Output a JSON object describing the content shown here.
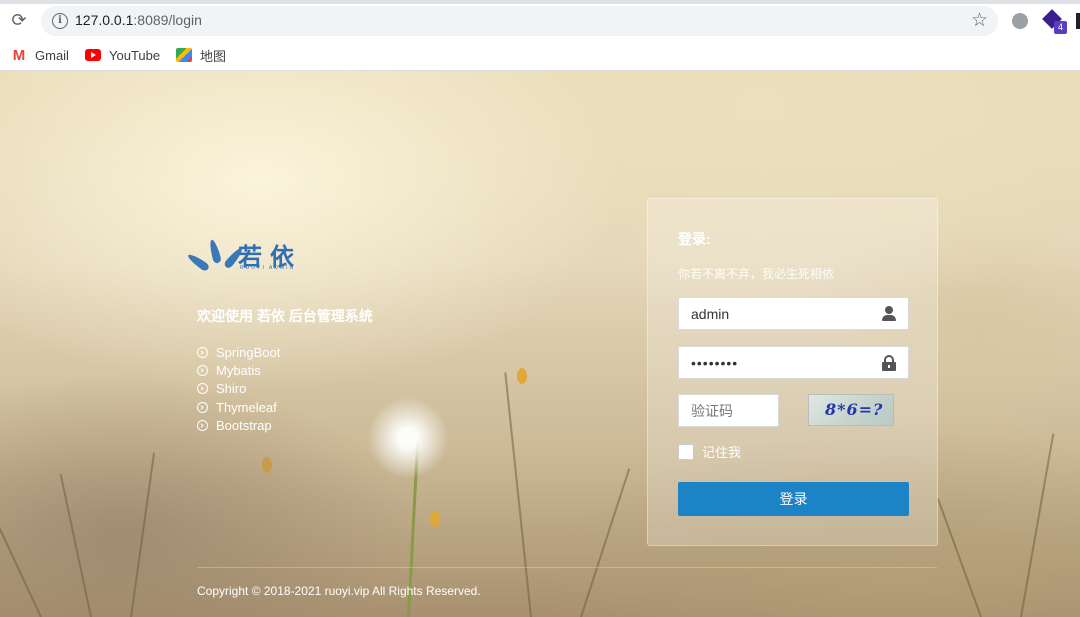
{
  "browser": {
    "url_host": "127.0.0.1",
    "url_rest": ":8089/login",
    "extension_badge": "4",
    "bookmarks": [
      {
        "label": "Gmail",
        "icon": "gmail-icon"
      },
      {
        "label": "YouTube",
        "icon": "youtube-icon"
      },
      {
        "label": "地图",
        "icon": "maps-icon"
      }
    ]
  },
  "brand": {
    "logo_text": "若依",
    "logo_subtext": "RUOYI ADMIN",
    "welcome": "欢迎使用 若依 后台管理系统",
    "features": [
      "SpringBoot",
      "Mybatis",
      "Shiro",
      "Thymeleaf",
      "Bootstrap"
    ]
  },
  "login": {
    "title": "登录:",
    "subtitle": "你若不离不弃，我必生死相依",
    "username_value": "admin",
    "password_value": "••••••••",
    "captcha_placeholder": "验证码",
    "captcha_text": "8*6=?",
    "remember_label": "记住我",
    "submit_label": "登录"
  },
  "footer": {
    "copyright": "Copyright © 2018-2021 ruoyi.vip All Rights Reserved."
  },
  "colors": {
    "primary_button": "#1c84c6",
    "logo_blue": "#2f6fb3"
  }
}
